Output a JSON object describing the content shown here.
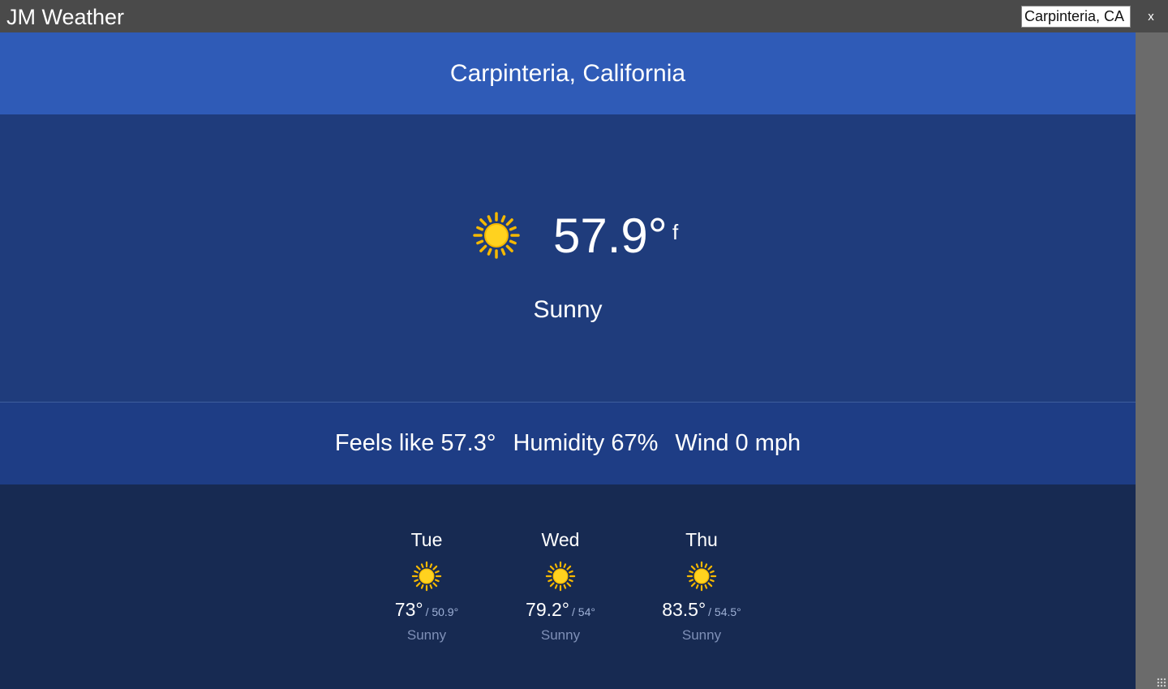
{
  "app": {
    "title": "JM Weather",
    "close_label": "x"
  },
  "search": {
    "value": "Carpinteria, CA"
  },
  "location": {
    "name": "Carpinteria, California"
  },
  "current": {
    "temperature": "57.9°",
    "unit": "f",
    "condition": "Sunny",
    "icon": "sun-icon",
    "feels_like": "Feels like 57.3°",
    "humidity": "Humidity 67%",
    "wind": "Wind 0 mph"
  },
  "forecast": [
    {
      "day": "Tue",
      "high": "73°",
      "low": "/ 50.9°",
      "condition": "Sunny",
      "icon": "sun-icon"
    },
    {
      "day": "Wed",
      "high": "79.2°",
      "low": "/ 54°",
      "condition": "Sunny",
      "icon": "sun-icon"
    },
    {
      "day": "Thu",
      "high": "83.5°",
      "low": "/ 54.5°",
      "condition": "Sunny",
      "icon": "sun-icon"
    }
  ],
  "colors": {
    "titlebar": "#4a4a4a",
    "header": "#2f5bb7",
    "current_bg": "#1f3c7c",
    "details_bg": "#1e3d85",
    "forecast_bg": "#172a52",
    "sun": "#f5b800"
  }
}
